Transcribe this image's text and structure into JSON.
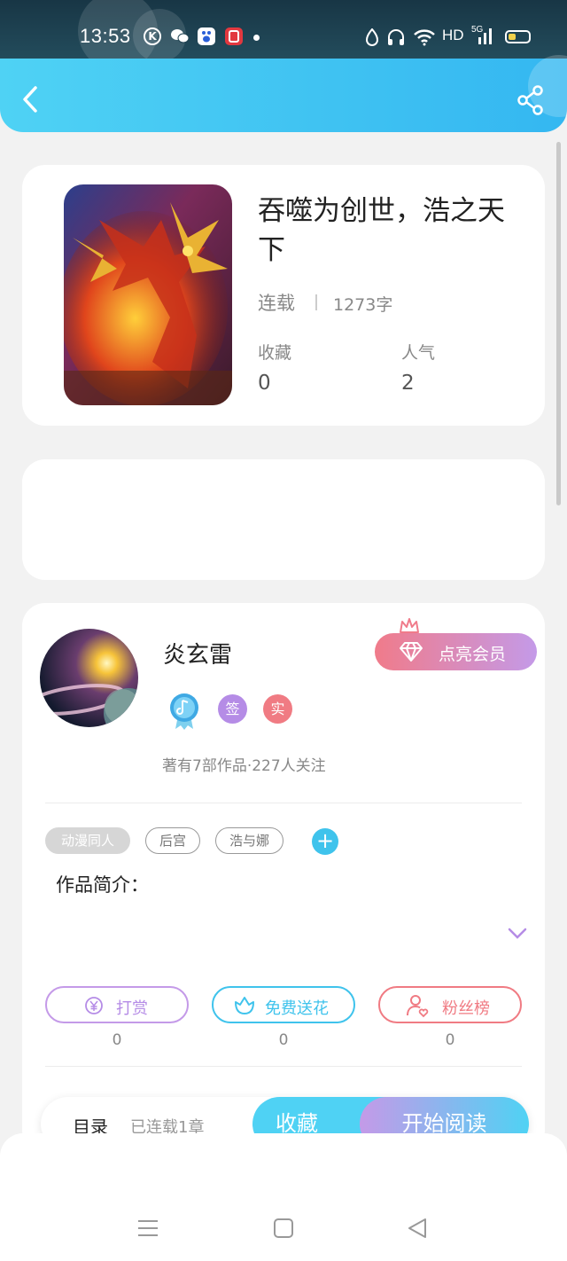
{
  "status_bar": {
    "time": "13:53",
    "network": "HD",
    "signal": "5G"
  },
  "book": {
    "title": "吞噬为创世，浩之天下",
    "status": "连载",
    "word_count": "1273字",
    "favorites_label": "收藏",
    "favorites_value": "0",
    "popularity_label": "人气",
    "popularity_value": "2"
  },
  "author": {
    "name": "炎玄雷",
    "vip_label": "点亮会员",
    "badge_sign": "签",
    "badge_real": "实",
    "meta": "著有7部作品·227人关注"
  },
  "tags": [
    "动漫同人",
    "后宫",
    "浩与娜"
  ],
  "intro_label": "作品简介：",
  "actions": {
    "reward_label": "打赏",
    "reward_count": "0",
    "flower_label": "免费送花",
    "flower_count": "0",
    "fans_label": "粉丝榜",
    "fans_count": "0"
  },
  "bottom_bar": {
    "toc_label": "目录",
    "chapters_text": "已连载1章",
    "collect_label": "收藏",
    "read_label": "开始阅读"
  },
  "colors": {
    "accent_blue": "#4fd2f4",
    "accent_purple": "#c49ae8",
    "accent_pink": "#f07b83"
  }
}
